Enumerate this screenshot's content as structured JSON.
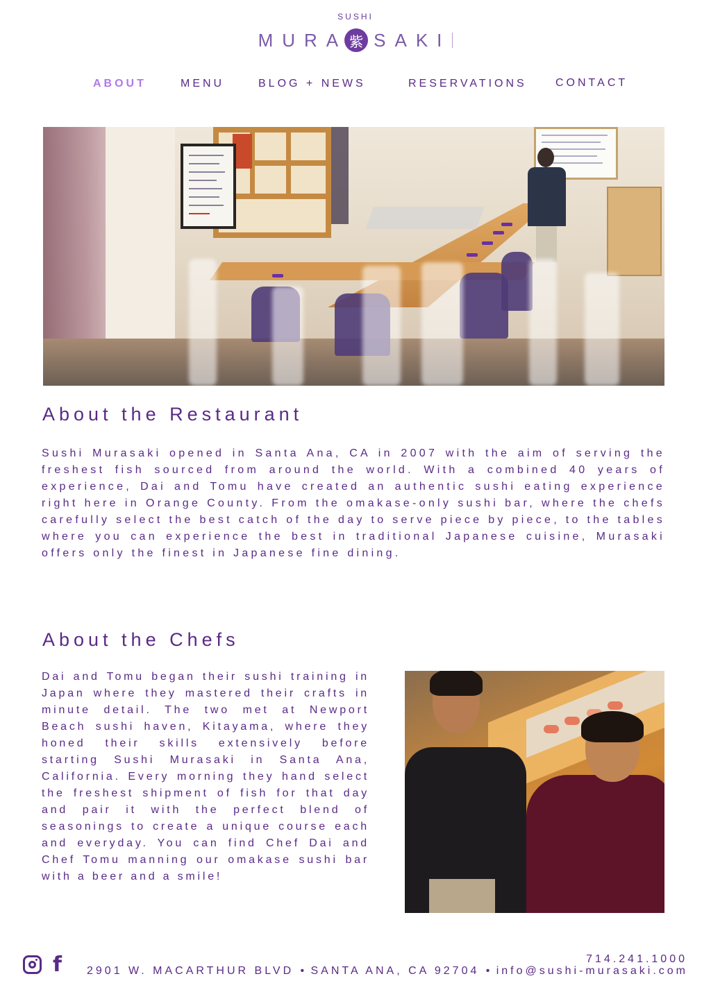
{
  "brand": {
    "small_label": "SUSHI",
    "name_left": "MURA",
    "seal_char": "紫",
    "name_right": "SAKI"
  },
  "nav": {
    "items": [
      {
        "label": "ABOUT",
        "active": true
      },
      {
        "label": "MENU",
        "active": false
      },
      {
        "label": "BLOG + NEWS",
        "active": false
      },
      {
        "label": "RESERVATIONS",
        "active": false
      },
      {
        "label": "CONTACT",
        "active": false
      }
    ]
  },
  "about_restaurant": {
    "heading": "About the Restaurant",
    "body": "Sushi Murasaki opened in Santa Ana, CA in 2007 with the aim of serving the freshest fish sourced from around the world. With a combined 40 years of experience, Dai and Tomu have created an authentic sushi eating experience right here in Orange County. From the omakase-only sushi bar, where the chefs carefully select the best catch of the day to serve piece by piece, to the tables where you can experience the best in traditional Japanese cuisine, Murasaki offers only the finest in Japanese fine dining."
  },
  "about_chefs": {
    "heading": "About the Chefs",
    "body": "Dai and Tomu began their sushi training in Japan where they mastered their crafts in minute detail. The two met at Newport Beach sushi haven, Kitayama, where they honed their skills extensively before starting Sushi Murasaki in Santa Ana, California. Every morning they hand select the freshest shipment of fish for that day and pair it with the perfect blend of seasonings to create a unique course each and everyday. You can find Chef Dai and Chef Tomu manning our omakase sushi bar with a beer and a smile!"
  },
  "footer": {
    "phone": "714.241.1000",
    "address": "2901 W. MACARTHUR BLVD",
    "separator": "•",
    "city": "SANTA ANA, CA 92704",
    "email": "info@sushi-murasaki.com"
  },
  "colors": {
    "brand_purple": "#5a2a86",
    "nav_active": "#b178e8"
  },
  "icons": {
    "instagram": "instagram-icon",
    "facebook": "facebook-icon"
  }
}
